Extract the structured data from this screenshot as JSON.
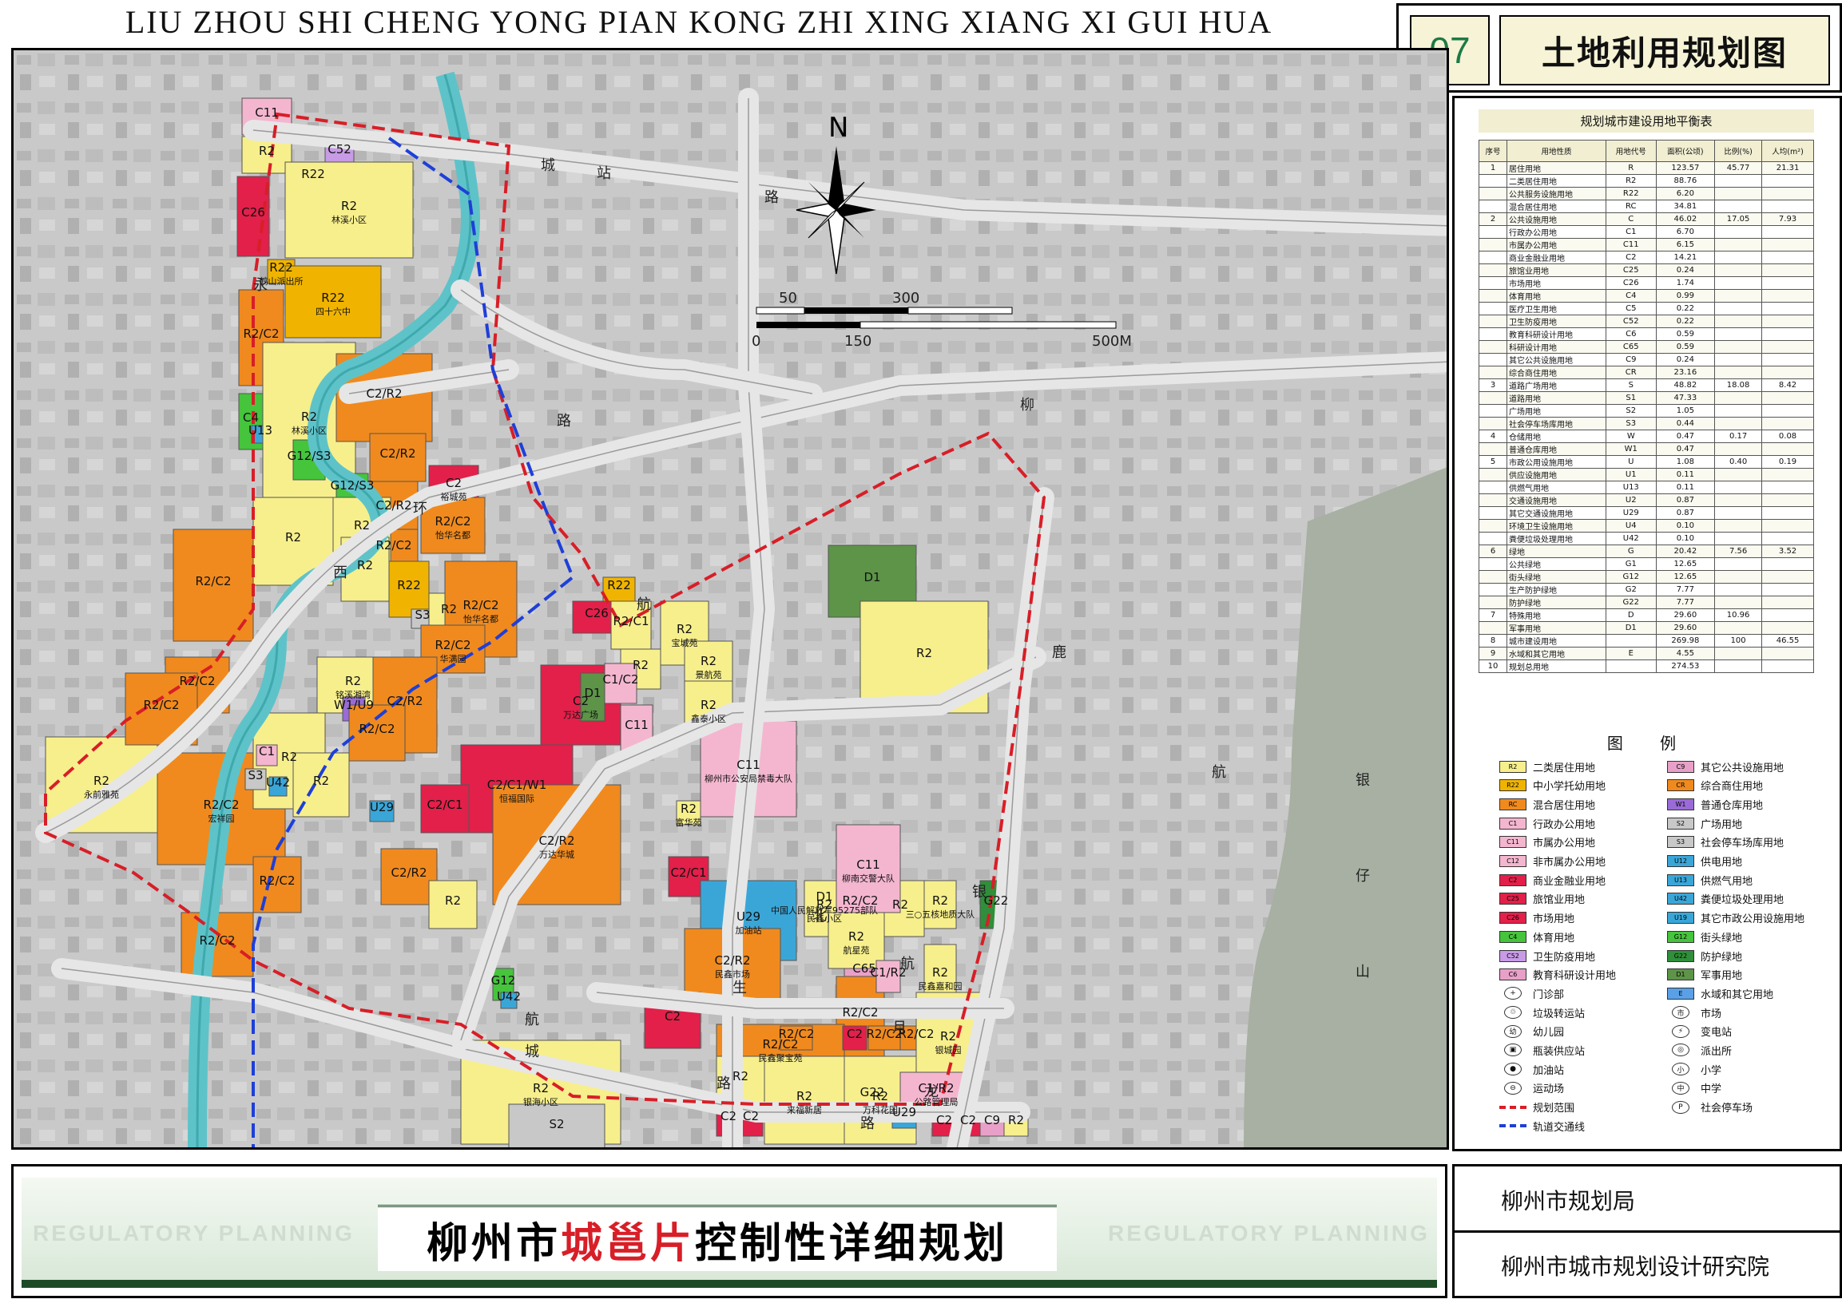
{
  "header": {
    "pinyin_title": "LIU ZHOU SHI CHENG YONG PIAN KONG ZHI XING XIANG XI GUI HUA",
    "sheet_number": "07",
    "sheet_title": "土地利用规划图"
  },
  "map": {
    "north_label": "N",
    "scale": {
      "top_ticks": [
        "50",
        "300"
      ],
      "bottom_ticks": [
        "0",
        "150",
        "500M"
      ]
    },
    "mountain_label": [
      "银",
      "仔",
      "山"
    ],
    "road_labels": [
      "站",
      "路",
      "城",
      "永",
      "西",
      "环",
      "路",
      "柳",
      "航",
      "银",
      "路",
      "北",
      "航",
      "生",
      "月",
      "路",
      "航",
      "城",
      "鹿",
      "龙",
      "航"
    ],
    "parcels": [
      {
        "code": "C11",
        "name": ""
      },
      {
        "code": "R2",
        "name": ""
      },
      {
        "code": "C26",
        "name": ""
      },
      {
        "code": "C52",
        "name": ""
      },
      {
        "code": "R22",
        "name": ""
      },
      {
        "code": "R2",
        "name": "林溪小区"
      },
      {
        "code": "R22",
        "name": "鹤山派出所"
      },
      {
        "code": "R2/C2",
        "name": ""
      },
      {
        "code": "R22",
        "name": "四十六中"
      },
      {
        "code": "C4",
        "name": ""
      },
      {
        "code": "U13",
        "name": ""
      },
      {
        "code": "R2",
        "name": "林溪小区"
      },
      {
        "code": "C2/R2",
        "name": ""
      },
      {
        "code": "G12/S3",
        "name": ""
      },
      {
        "code": "G12/S3",
        "name": ""
      },
      {
        "code": "C2/R2",
        "name": ""
      },
      {
        "code": "C2/R2",
        "name": ""
      },
      {
        "code": "C2",
        "name": "裕城苑"
      },
      {
        "code": "R2/C2",
        "name": ""
      },
      {
        "code": "R2/C2",
        "name": "怡华名都"
      },
      {
        "code": "R2",
        "name": ""
      },
      {
        "code": "R2",
        "name": ""
      },
      {
        "code": "R2/C2",
        "name": ""
      },
      {
        "code": "R2/C2",
        "name": ""
      },
      {
        "code": "R2",
        "name": "永前雅苑"
      },
      {
        "code": "R2/C2",
        "name": ""
      },
      {
        "code": "R2/C2",
        "name": "宏祥园"
      },
      {
        "code": "R2/C2",
        "name": ""
      },
      {
        "code": "R2",
        "name": ""
      },
      {
        "code": "R22",
        "name": ""
      },
      {
        "code": "S3",
        "name": ""
      },
      {
        "code": "R2",
        "name": ""
      },
      {
        "code": "R2/C2",
        "name": "怡华名都"
      },
      {
        "code": "R2/C2",
        "name": "华满园"
      },
      {
        "code": "R2",
        "name": "铭溪湘湾"
      },
      {
        "code": "W1/U9",
        "name": ""
      },
      {
        "code": "C2/R2",
        "name": ""
      },
      {
        "code": "R2",
        "name": ""
      },
      {
        "code": "C1",
        "name": ""
      },
      {
        "code": "S3",
        "name": ""
      },
      {
        "code": "R2",
        "name": ""
      },
      {
        "code": "R2/C2",
        "name": ""
      },
      {
        "code": "U29",
        "name": ""
      },
      {
        "code": "R2/C2",
        "name": ""
      },
      {
        "code": "C2/C1/W1",
        "name": "恒福国际"
      },
      {
        "code": "C2/C1",
        "name": ""
      },
      {
        "code": "C2/R2",
        "name": ""
      },
      {
        "code": "R2",
        "name": ""
      },
      {
        "code": "C2",
        "name": "万达广场"
      },
      {
        "code": "C2/R2",
        "name": "万达华城"
      },
      {
        "code": "R22",
        "name": ""
      },
      {
        "code": "C26",
        "name": ""
      },
      {
        "code": "R2/C1",
        "name": ""
      },
      {
        "code": "R2",
        "name": ""
      },
      {
        "code": "R2",
        "name": "宝城苑"
      },
      {
        "code": "R2",
        "name": "景航苑"
      },
      {
        "code": "R2",
        "name": "鑫泰小区"
      },
      {
        "code": "C1/C2",
        "name": ""
      },
      {
        "code": "D1",
        "name": ""
      },
      {
        "code": "C11",
        "name": ""
      },
      {
        "code": "C11",
        "name": "柳州市公安局禁毒大队"
      },
      {
        "code": "R2",
        "name": "富华苑"
      },
      {
        "code": "C2/C1",
        "name": ""
      },
      {
        "code": "D1",
        "name": ""
      },
      {
        "code": "R2",
        "name": ""
      },
      {
        "code": "D1",
        "name": "中国人民解放军95275部队"
      },
      {
        "code": "U29",
        "name": "加油站"
      },
      {
        "code": "C2/R2",
        "name": "民鑫市场"
      },
      {
        "code": "R2",
        "name": "民鑫小区"
      },
      {
        "code": "R2/C2",
        "name": ""
      },
      {
        "code": "R2",
        "name": ""
      },
      {
        "code": "R2",
        "name": "三○五核地质大队"
      },
      {
        "code": "C65",
        "name": ""
      },
      {
        "code": "R2",
        "name": "民鑫嘉和园"
      },
      {
        "code": "C11",
        "name": "柳南交警大队"
      },
      {
        "code": "R2",
        "name": "航星苑"
      },
      {
        "code": "R2/C2",
        "name": ""
      },
      {
        "code": "C1/R2",
        "name": ""
      },
      {
        "code": "G22",
        "name": ""
      },
      {
        "code": "G22",
        "name": ""
      },
      {
        "code": "R2/C2",
        "name": "民鑫聚宝苑"
      },
      {
        "code": "C2",
        "name": ""
      },
      {
        "code": "R2/C2",
        "name": ""
      },
      {
        "code": "R2/C2",
        "name": ""
      },
      {
        "code": "R2/C2",
        "name": ""
      },
      {
        "code": "R2",
        "name": ""
      },
      {
        "code": "R2",
        "name": "来福新居"
      },
      {
        "code": "R2",
        "name": "万科花园"
      },
      {
        "code": "C2",
        "name": ""
      },
      {
        "code": "C2",
        "name": ""
      },
      {
        "code": "R2",
        "name": "银城园"
      },
      {
        "code": "C1/R2",
        "name": "公路管理局"
      },
      {
        "code": "U29",
        "name": ""
      },
      {
        "code": "C2",
        "name": ""
      },
      {
        "code": "C2",
        "name": ""
      },
      {
        "code": "C9",
        "name": ""
      },
      {
        "code": "R2",
        "name": ""
      },
      {
        "code": "R2",
        "name": "银海小区"
      },
      {
        "code": "S2",
        "name": ""
      },
      {
        "code": "C2",
        "name": ""
      },
      {
        "code": "U42",
        "name": ""
      },
      {
        "code": "G12",
        "name": ""
      },
      {
        "code": "U42",
        "name": ""
      }
    ]
  },
  "balance_table": {
    "title": "规划城市建设用地平衡表",
    "columns": [
      "序号",
      "用地性质",
      "用地代号",
      "面积(公顷)",
      "比例(%)",
      "人均(m²)"
    ],
    "rows": [
      [
        "1",
        "居住用地",
        "R",
        "123.57",
        "45.77",
        "21.31"
      ],
      [
        "",
        "二类居住用地",
        "R2",
        "88.76",
        "",
        ""
      ],
      [
        "",
        "公共服务设施用地",
        "R22",
        "6.20",
        "",
        ""
      ],
      [
        "",
        "混合居住用地",
        "RC",
        "34.81",
        "",
        ""
      ],
      [
        "2",
        "公共设施用地",
        "C",
        "46.02",
        "17.05",
        "7.93"
      ],
      [
        "",
        "行政办公用地",
        "C1",
        "6.70",
        "",
        ""
      ],
      [
        "",
        "市属办公用地",
        "C11",
        "6.15",
        "",
        ""
      ],
      [
        "",
        "商业金融业用地",
        "C2",
        "14.21",
        "",
        ""
      ],
      [
        "",
        "旅馆业用地",
        "C25",
        "0.24",
        "",
        ""
      ],
      [
        "",
        "市场用地",
        "C26",
        "1.74",
        "",
        ""
      ],
      [
        "",
        "体育用地",
        "C4",
        "0.99",
        "",
        ""
      ],
      [
        "",
        "医疗卫生用地",
        "C5",
        "0.22",
        "",
        ""
      ],
      [
        "",
        "卫生防疫用地",
        "C52",
        "0.22",
        "",
        ""
      ],
      [
        "",
        "教育科研设计用地",
        "C6",
        "0.59",
        "",
        ""
      ],
      [
        "",
        "科研设计用地",
        "C65",
        "0.59",
        "",
        ""
      ],
      [
        "",
        "其它公共设施用地",
        "C9",
        "0.24",
        "",
        ""
      ],
      [
        "",
        "综合商住用地",
        "CR",
        "23.16",
        "",
        ""
      ],
      [
        "3",
        "道路广场用地",
        "S",
        "48.82",
        "18.08",
        "8.42"
      ],
      [
        "",
        "道路用地",
        "S1",
        "47.33",
        "",
        ""
      ],
      [
        "",
        "广场用地",
        "S2",
        "1.05",
        "",
        ""
      ],
      [
        "",
        "社会停车场库用地",
        "S3",
        "0.44",
        "",
        ""
      ],
      [
        "4",
        "仓储用地",
        "W",
        "0.47",
        "0.17",
        "0.08"
      ],
      [
        "",
        "普通仓库用地",
        "W1",
        "0.47",
        "",
        ""
      ],
      [
        "5",
        "市政公用设施用地",
        "U",
        "1.08",
        "0.40",
        "0.19"
      ],
      [
        "",
        "供应设施用地",
        "U1",
        "0.11",
        "",
        ""
      ],
      [
        "",
        "供燃气用地",
        "U13",
        "0.11",
        "",
        ""
      ],
      [
        "",
        "交通设施用地",
        "U2",
        "0.87",
        "",
        ""
      ],
      [
        "",
        "其它交通设施用地",
        "U29",
        "0.87",
        "",
        ""
      ],
      [
        "",
        "环境卫生设施用地",
        "U4",
        "0.10",
        "",
        ""
      ],
      [
        "",
        "粪便垃圾处理用地",
        "U42",
        "0.10",
        "",
        ""
      ],
      [
        "6",
        "绿地",
        "G",
        "20.42",
        "7.56",
        "3.52"
      ],
      [
        "",
        "公共绿地",
        "G1",
        "12.65",
        "",
        ""
      ],
      [
        "",
        "街头绿地",
        "G12",
        "12.65",
        "",
        ""
      ],
      [
        "",
        "生产防护绿地",
        "G2",
        "7.77",
        "",
        ""
      ],
      [
        "",
        "防护绿地",
        "G22",
        "7.77",
        "",
        ""
      ],
      [
        "7",
        "特殊用地",
        "D",
        "29.60",
        "10.96",
        ""
      ],
      [
        "",
        "军事用地",
        "D1",
        "29.60",
        "",
        ""
      ],
      [
        "8",
        "城市建设用地",
        "",
        "269.98",
        "100",
        "46.55"
      ],
      [
        "9",
        "水域和其它用地",
        "E",
        "4.55",
        "",
        ""
      ],
      [
        "10",
        "规划总用地",
        "",
        "274.53",
        "",
        ""
      ]
    ],
    "sub_marker": "其中"
  },
  "legend": {
    "title": "图 例",
    "items": [
      {
        "code": "R2",
        "label": "二类居住用地",
        "color": "#f7ef8c",
        "kind": "swatch"
      },
      {
        "code": "C9",
        "label": "其它公共设施用地",
        "color": "#e8a0c8",
        "kind": "swatch"
      },
      {
        "code": "R22",
        "label": "中小学托幼用地",
        "color": "#f0b400",
        "kind": "swatch"
      },
      {
        "code": "CR",
        "label": "综合商住用地",
        "color": "#f08a1e",
        "kind": "swatch"
      },
      {
        "code": "RC",
        "label": "混合居住用地",
        "color": "#f08a1e",
        "kind": "swatch"
      },
      {
        "code": "W1",
        "label": "普通仓库用地",
        "color": "#9a6bd6",
        "kind": "swatch"
      },
      {
        "code": "C1",
        "label": "行政办公用地",
        "color": "#f4b6cf",
        "kind": "swatch"
      },
      {
        "code": "S2",
        "label": "广场用地",
        "color": "#c8c8c8",
        "kind": "swatch"
      },
      {
        "code": "C11",
        "label": "市属办公用地",
        "color": "#f4b6cf",
        "kind": "swatch"
      },
      {
        "code": "S3",
        "label": "社会停车场库用地",
        "color": "#c8c8c8",
        "kind": "swatch"
      },
      {
        "code": "C12",
        "label": "非市属办公用地",
        "color": "#f4b6cf",
        "kind": "swatch"
      },
      {
        "code": "U12",
        "label": "供电用地",
        "color": "#3aa6d8",
        "kind": "swatch"
      },
      {
        "code": "C2",
        "label": "商业金融业用地",
        "color": "#e2204a",
        "kind": "swatch"
      },
      {
        "code": "U13",
        "label": "供燃气用地",
        "color": "#3aa6d8",
        "kind": "swatch"
      },
      {
        "code": "C25",
        "label": "旅馆业用地",
        "color": "#e2204a",
        "kind": "swatch"
      },
      {
        "code": "U42",
        "label": "粪便垃圾处理用地",
        "color": "#3aa6d8",
        "kind": "swatch"
      },
      {
        "code": "C26",
        "label": "市场用地",
        "color": "#e2204a",
        "kind": "swatch"
      },
      {
        "code": "U19",
        "label": "其它市政公用设施用地",
        "color": "#3aa6d8",
        "kind": "swatch"
      },
      {
        "code": "C4",
        "label": "体育用地",
        "color": "#45c43c",
        "kind": "swatch"
      },
      {
        "code": "G12",
        "label": "街头绿地",
        "color": "#45c43c",
        "kind": "swatch"
      },
      {
        "code": "C52",
        "label": "卫生防疫用地",
        "color": "#c79be6",
        "kind": "swatch"
      },
      {
        "code": "G22",
        "label": "防护绿地",
        "color": "#2f8f3a",
        "kind": "swatch"
      },
      {
        "code": "C6",
        "label": "教育科研设计用地",
        "color": "#e8a0c8",
        "kind": "swatch"
      },
      {
        "code": "D1",
        "label": "军事用地",
        "color": "#5d9448",
        "kind": "swatch"
      },
      {
        "code": "+",
        "label": "门诊部",
        "color": "",
        "kind": "circle"
      },
      {
        "code": "E",
        "label": "水域和其它用地",
        "color": "#5aa0e6",
        "kind": "swatch"
      },
      {
        "code": "♲",
        "label": "垃圾转运站",
        "color": "",
        "kind": "circle"
      },
      {
        "code": "市",
        "label": "市场",
        "color": "",
        "kind": "circle"
      },
      {
        "code": "幼",
        "label": "幼儿园",
        "color": "",
        "kind": "circle"
      },
      {
        "code": "⚡",
        "label": "变电站",
        "color": "",
        "kind": "circle"
      },
      {
        "code": "▣",
        "label": "瓶装供应站",
        "color": "",
        "kind": "circle"
      },
      {
        "code": "◎",
        "label": "派出所",
        "color": "",
        "kind": "circle"
      },
      {
        "code": "●",
        "label": "加油站",
        "color": "",
        "kind": "circle"
      },
      {
        "code": "小",
        "label": "小学",
        "color": "",
        "kind": "circle"
      },
      {
        "code": "⊖",
        "label": "运动场",
        "color": "",
        "kind": "circle"
      },
      {
        "code": "中",
        "label": "中学",
        "color": "",
        "kind": "circle"
      },
      {
        "code": "",
        "label": "规划范围",
        "color": "#d81e27",
        "kind": "line-dash"
      },
      {
        "code": "P",
        "label": "社会停车场",
        "color": "",
        "kind": "circle"
      },
      {
        "code": "",
        "label": "轨道交通线",
        "color": "#1e3fd8",
        "kind": "line-dash"
      }
    ]
  },
  "footer": {
    "english_left": "REGULATORY PLANNING",
    "english_right": "REGULATORY PLANNING",
    "title_part1": "柳州市",
    "title_highlight": "城邕片",
    "title_part2": "控制性详细规划",
    "org_1": "柳州市规划局",
    "org_2": "柳州市城市规划设计研究院"
  }
}
